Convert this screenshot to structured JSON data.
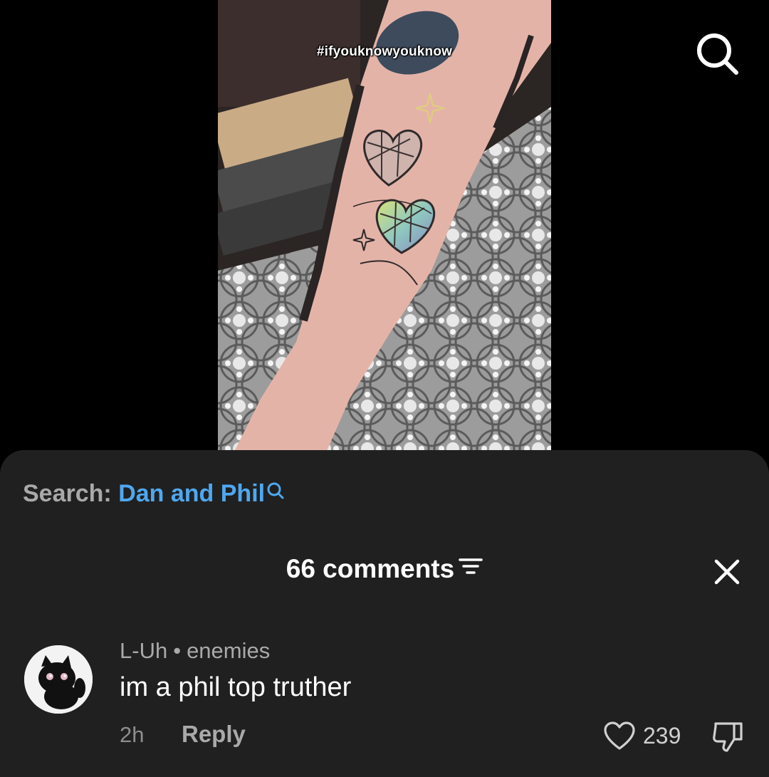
{
  "video": {
    "hashtag": "#ifyouknowyouknow",
    "top_search_icon": "search-icon"
  },
  "search_suggestion": {
    "prefix": "Search:",
    "term": "Dan and Phil",
    "icon": "search-icon"
  },
  "comments_panel": {
    "title": "66 comments",
    "filter_icon": "filter-icon",
    "close_icon": "close-icon"
  },
  "comments": [
    {
      "username": "L-Uh",
      "separator": "•",
      "tag": "enemies",
      "text": "im a phil top truther",
      "time": "2h",
      "reply_label": "Reply",
      "likes": "239",
      "like_icon": "heart-icon",
      "dislike_icon": "thumbs-down-icon",
      "avatar_icon": "black-cat-avatar"
    }
  ],
  "colors": {
    "background": "#000000",
    "sheet": "#202020",
    "link": "#4ea8f0",
    "muted_text": "#a9a9a9",
    "primary_text": "#ffffff"
  }
}
